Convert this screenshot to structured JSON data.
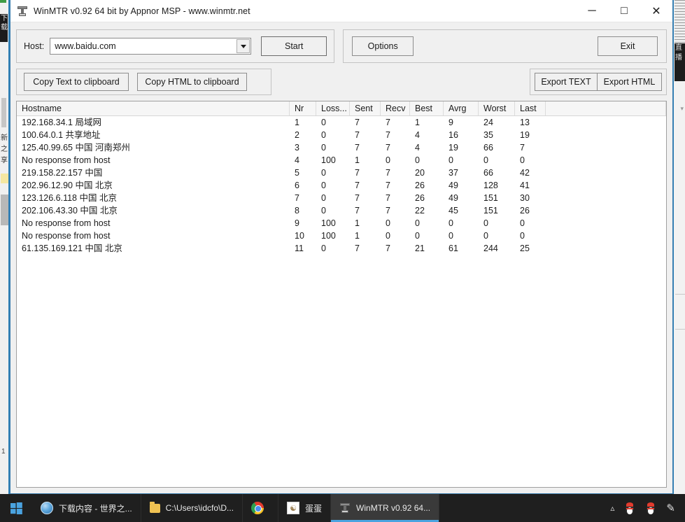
{
  "window": {
    "title": "WinMTR v0.92 64 bit by Appnor MSP - www.winmtr.net",
    "icon": "winmtr-icon",
    "minimize_label": "─",
    "maximize_label": "□",
    "close_label": "✕"
  },
  "host_panel": {
    "label": "Host:",
    "value": "www.baidu.com",
    "placeholder": "",
    "dropdown_icon": "chevron-down-icon",
    "start_label": "Start"
  },
  "action_panel": {
    "options_label": "Options",
    "exit_label": "Exit"
  },
  "clipboard_panel": {
    "copy_text_label": "Copy Text to clipboard",
    "copy_html_label": "Copy HTML to clipboard"
  },
  "export_panel": {
    "export_text_label": "Export TEXT",
    "export_html_label": "Export HTML"
  },
  "table": {
    "columns": [
      "Hostname",
      "Nr",
      "Loss...",
      "Sent",
      "Recv",
      "Best",
      "Avrg",
      "Worst",
      "Last"
    ],
    "rows": [
      {
        "hostname": "192.168.34.1 局域网",
        "nr": "1",
        "loss": "0",
        "sent": "7",
        "recv": "7",
        "best": "1",
        "avrg": "9",
        "worst": "24",
        "last": "13"
      },
      {
        "hostname": "100.64.0.1 共享地址",
        "nr": "2",
        "loss": "0",
        "sent": "7",
        "recv": "7",
        "best": "4",
        "avrg": "16",
        "worst": "35",
        "last": "19"
      },
      {
        "hostname": "125.40.99.65 中国 河南郑州",
        "nr": "3",
        "loss": "0",
        "sent": "7",
        "recv": "7",
        "best": "4",
        "avrg": "19",
        "worst": "66",
        "last": "7"
      },
      {
        "hostname": "No response from host",
        "nr": "4",
        "loss": "100",
        "sent": "1",
        "recv": "0",
        "best": "0",
        "avrg": "0",
        "worst": "0",
        "last": "0"
      },
      {
        "hostname": "219.158.22.157 中国",
        "nr": "5",
        "loss": "0",
        "sent": "7",
        "recv": "7",
        "best": "20",
        "avrg": "37",
        "worst": "66",
        "last": "42"
      },
      {
        "hostname": "202.96.12.90 中国 北京",
        "nr": "6",
        "loss": "0",
        "sent": "7",
        "recv": "7",
        "best": "26",
        "avrg": "49",
        "worst": "128",
        "last": "41"
      },
      {
        "hostname": "123.126.6.118 中国 北京",
        "nr": "7",
        "loss": "0",
        "sent": "7",
        "recv": "7",
        "best": "26",
        "avrg": "49",
        "worst": "151",
        "last": "30"
      },
      {
        "hostname": "202.106.43.30 中国 北京",
        "nr": "8",
        "loss": "0",
        "sent": "7",
        "recv": "7",
        "best": "22",
        "avrg": "45",
        "worst": "151",
        "last": "26"
      },
      {
        "hostname": "No response from host",
        "nr": "9",
        "loss": "100",
        "sent": "1",
        "recv": "0",
        "best": "0",
        "avrg": "0",
        "worst": "0",
        "last": "0"
      },
      {
        "hostname": "No response from host",
        "nr": "10",
        "loss": "100",
        "sent": "1",
        "recv": "0",
        "best": "0",
        "avrg": "0",
        "worst": "0",
        "last": "0"
      },
      {
        "hostname": "61.135.169.121 中国 北京",
        "nr": "11",
        "loss": "0",
        "sent": "7",
        "recv": "7",
        "best": "21",
        "avrg": "61",
        "worst": "244",
        "last": "25"
      }
    ]
  },
  "taskbar": {
    "start_icon": "windows-start-icon",
    "items": [
      {
        "label": "下载内容 - 世界之...",
        "icon": "internet-explorer-icon",
        "active": false
      },
      {
        "label": "C:\\Users\\idcfo\\D...",
        "icon": "folder-icon",
        "active": false
      },
      {
        "label": "",
        "icon": "chrome-icon",
        "active": false
      },
      {
        "label": "蛋蛋",
        "icon": "app-icon",
        "active": false
      },
      {
        "label": "WinMTR v0.92 64...",
        "icon": "winmtr-icon",
        "active": true
      }
    ],
    "tray": [
      {
        "name": "show-hidden-icons",
        "glyph": "⌃"
      },
      {
        "name": "qq-penguin-icon",
        "glyph": ""
      },
      {
        "name": "qq-penguin-icon-2",
        "glyph": ""
      },
      {
        "name": "pen-input-icon",
        "glyph": "✐"
      }
    ]
  },
  "background": {
    "left_strip_text": "下载",
    "left_vertical_text": "新之享",
    "right_strip_text": "直播"
  },
  "colors": {
    "window_border": "#3d7fb0",
    "client_bg": "#f0f0f0",
    "title_bg": "#ffffff",
    "list_bg": "#ffffff",
    "taskbar_bg": "#1f1f1f",
    "taskbar_active": "#3a3a3a",
    "accent": "#4aa3e0"
  }
}
